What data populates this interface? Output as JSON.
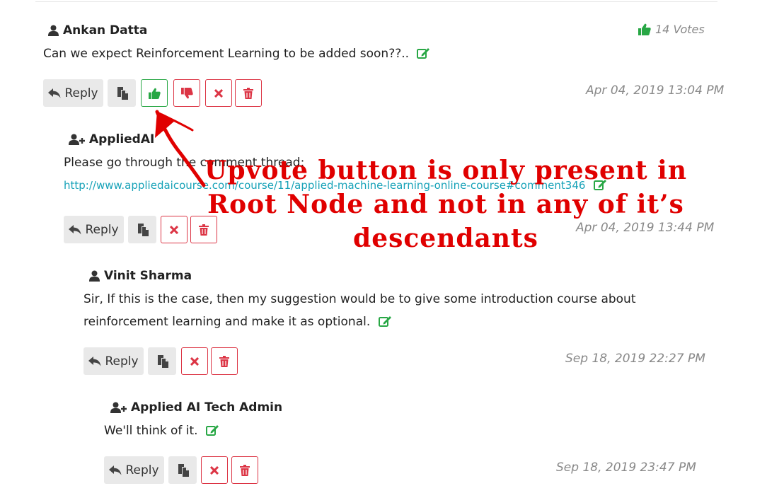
{
  "comments": [
    {
      "author": "Ankan Datta",
      "text": "Can we expect Reinforcement Learning to be added soon??..",
      "date": "Apr 04, 2019 13:04 PM",
      "votes": "14 Votes",
      "reply_label": "Reply"
    },
    {
      "author": "AppliedAI",
      "text": "Please go through the comment thread:",
      "link": "http://www.appliedaicourse.com/course/11/applied-machine-learning-online-course#comment346",
      "date": "Apr 04, 2019 13:44 PM",
      "reply_label": "Reply"
    },
    {
      "author": "Vinit Sharma",
      "text": "Sir, If this is the case, then my suggestion would be to give some introduction course about reinforcement learning and make it as optional.",
      "date": "Sep 18, 2019 22:27 PM",
      "reply_label": "Reply"
    },
    {
      "author": "Applied AI Tech Admin",
      "text": "We'll think of it.",
      "date": "Sep 18, 2019 23:47 PM",
      "reply_label": "Reply"
    }
  ],
  "annotation": {
    "text": "Upvote button is only present in Root Node and not in any of it’s descendants",
    "color": "#e00000"
  },
  "colors": {
    "green": "#28a745",
    "red": "#dc3545",
    "link": "#17a2b8",
    "muted": "#888888"
  }
}
